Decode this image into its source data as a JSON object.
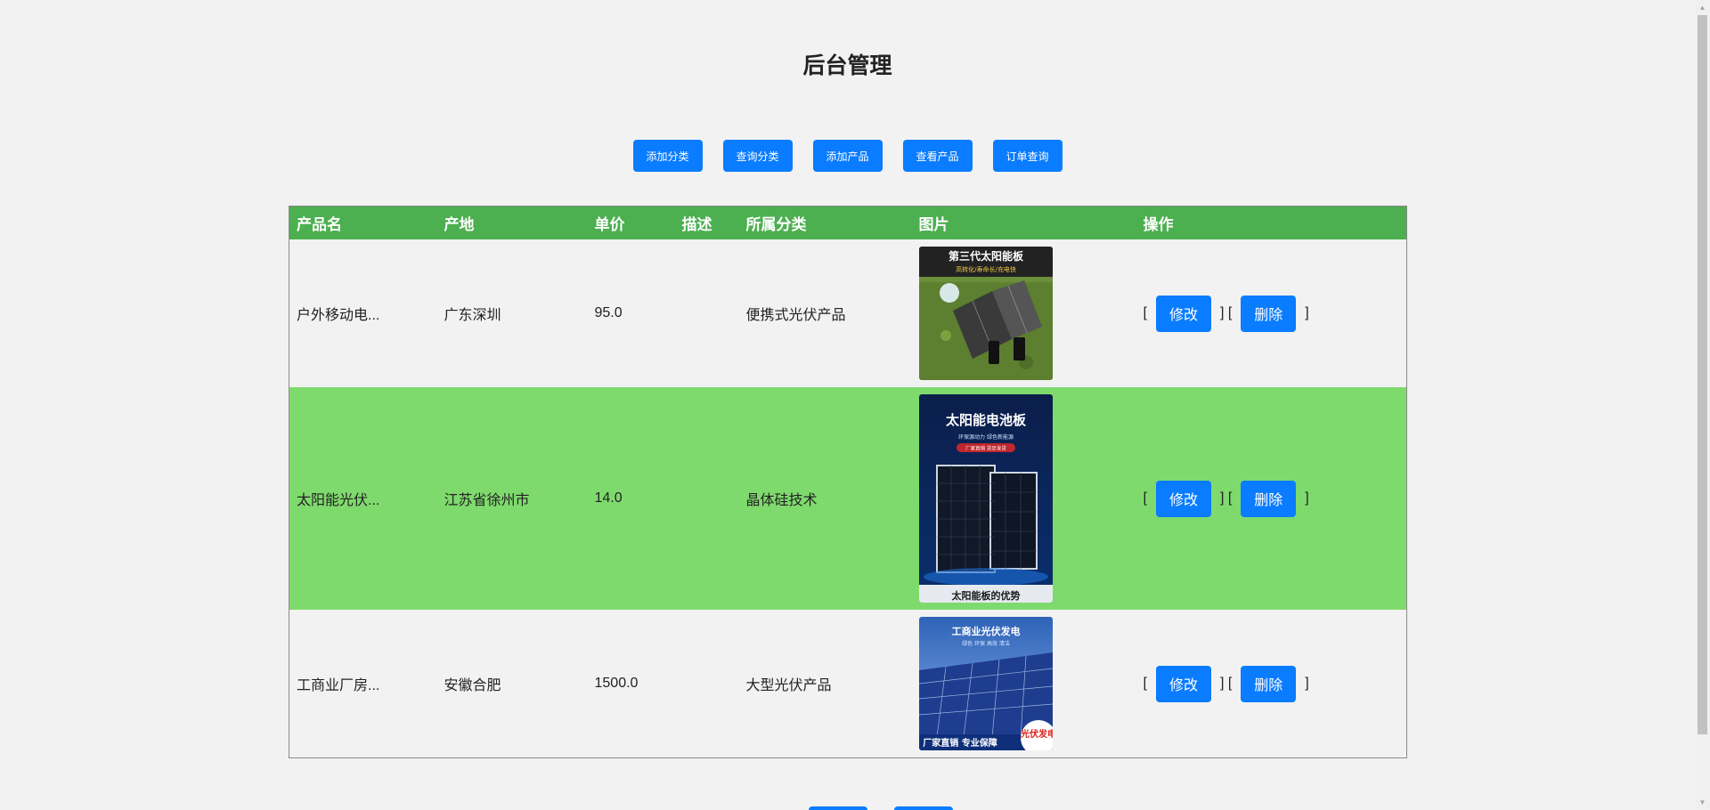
{
  "page": {
    "title": "后台管理"
  },
  "nav": {
    "buttons": [
      {
        "label": "添加分类"
      },
      {
        "label": "查询分类"
      },
      {
        "label": "添加产品"
      },
      {
        "label": "查看产品"
      },
      {
        "label": "订单查询"
      }
    ]
  },
  "table": {
    "headers": {
      "name": "产品名",
      "origin": "产地",
      "price": "单价",
      "desc": "描述",
      "category": "所属分类",
      "image": "图片",
      "ops": "操作"
    },
    "rows": [
      {
        "name": "户外移动电...",
        "origin": "广东深圳",
        "price": "95.0",
        "desc": "",
        "category": "便携式光伏产品",
        "image_title": "第三代太阳能板",
        "image_sub": "高转化/寿命长/充电快",
        "edit": "修改",
        "delete": "删除"
      },
      {
        "name": "太阳能光伏...",
        "origin": "江苏省徐州市",
        "price": "14.0",
        "desc": "",
        "category": "晶体硅技术",
        "image_title": "太阳能电池板",
        "image_sub": "环保源动力 绿色新能源",
        "image_tag": "厂家直销 货足发货",
        "image_footer": "太阳能板的优势",
        "edit": "修改",
        "delete": "删除"
      },
      {
        "name": "工商业厂房...",
        "origin": "安徽合肥",
        "price": "1500.0",
        "desc": "",
        "category": "大型光伏产品",
        "image_title": "工商业光伏发电",
        "image_sub": "绿色 环保 高效 清洁",
        "image_footer": "厂家直销 专业保障",
        "image_badge": "光伏发电",
        "edit": "修改",
        "delete": "删除"
      }
    ],
    "brackets": {
      "open": "[",
      "mid": "] [",
      "close": "]"
    }
  },
  "colors": {
    "header_green": "#4caf50",
    "row_green": "#7fda6d",
    "button_blue": "#0a7cff"
  }
}
